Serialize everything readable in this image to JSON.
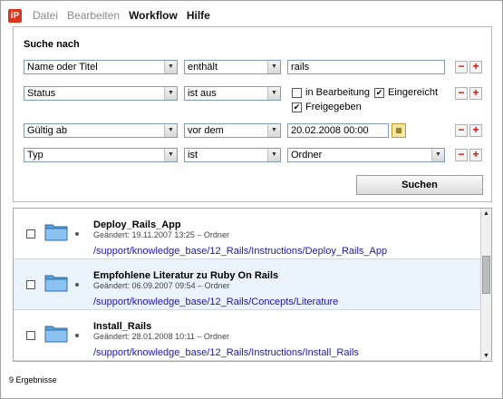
{
  "menu": {
    "app_icon": "app-logo",
    "items": [
      "Datei",
      "Bearbeiten",
      "Workflow",
      "Hilfe"
    ]
  },
  "search": {
    "title": "Suche nach",
    "rows": [
      {
        "field": "Name oder Titel",
        "operator": "enthält",
        "value": "rails"
      },
      {
        "field": "Status",
        "operator": "ist aus",
        "options": [
          {
            "label": "in Bearbeitung",
            "checked": false
          },
          {
            "label": "Eingereicht",
            "checked": true
          },
          {
            "label": "Freigegeben",
            "checked": true
          }
        ]
      },
      {
        "field": "Gültig ab",
        "operator": "vor dem",
        "value": "20.02.2008 00:00"
      },
      {
        "field": "Typ",
        "operator": "ist",
        "value": "Ordner"
      }
    ],
    "minus": "−",
    "plus": "+",
    "button": "Suchen"
  },
  "results": [
    {
      "title": "Deploy_Rails_App",
      "meta": "Geändert: 19.11.2007 13:25 – Ordner",
      "path": "/support/knowledge_base/12_Rails/Instructions/Deploy_Rails_App"
    },
    {
      "title": "Empfohlene Literatur zu Ruby On Rails",
      "meta": "Geändert: 06.09.2007 09:54 – Ordner",
      "path": "/support/knowledge_base/12_Rails/Concepts/Literature"
    },
    {
      "title": "Install_Rails",
      "meta": "Geändert: 28.01.2008 10:11 – Ordner",
      "path": "/support/knowledge_base/12_Rails/Instructions/Install_Rails"
    }
  ],
  "footer": {
    "count": "9 Ergebnisse"
  }
}
